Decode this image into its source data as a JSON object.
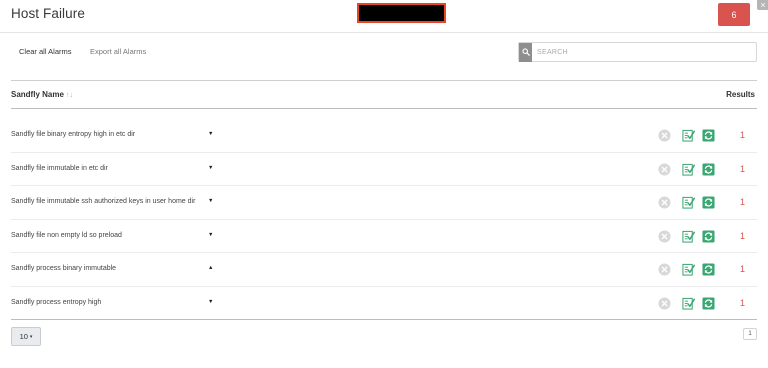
{
  "header": {
    "title": "Host Failure",
    "count": "6",
    "close_glyph": "×"
  },
  "actions": {
    "clear_all": "Clear all Alarms",
    "export_all": "Export all Alarms"
  },
  "search": {
    "placeholder": "SEARCH",
    "value": ""
  },
  "table": {
    "columns": {
      "name": "Sandfly Name",
      "name_sort_glyph": "↑↓",
      "results": "Results"
    },
    "rows": [
      {
        "name": "Sandfly file binary entropy high in etc dir",
        "caret": "▼",
        "result": "1"
      },
      {
        "name": "Sandfly file immutable in etc dir",
        "caret": "▼",
        "result": "1"
      },
      {
        "name": "Sandfly file immutable ssh authorized keys in user home dir",
        "caret": "▼",
        "result": "1"
      },
      {
        "name": "Sandfly file non empty ld so preload",
        "caret": "▼",
        "result": "1"
      },
      {
        "name": "Sandfly process binary immutable",
        "caret": "▲",
        "result": "1"
      },
      {
        "name": "Sandfly process entropy high",
        "caret": "▼",
        "result": "1"
      }
    ]
  },
  "pagination": {
    "page_size": "10",
    "page_size_caret": "▾",
    "current_page": "1"
  },
  "icons": {
    "search": "search-icon",
    "dismiss": "x-circle-icon",
    "check": "checklist-icon",
    "refresh": "refresh-icon"
  },
  "colors": {
    "badge_red": "#d9534f",
    "result_red": "#d9534f",
    "icon_green": "#3aa672",
    "icon_gray": "#d3d3d3"
  }
}
